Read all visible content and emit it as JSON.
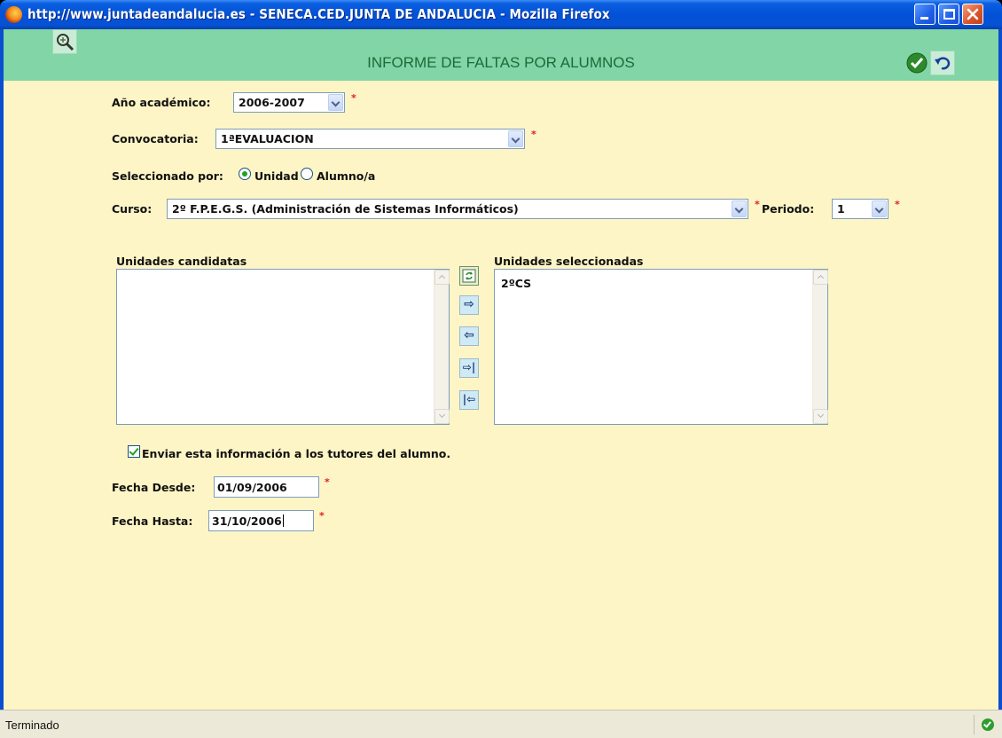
{
  "window": {
    "title": "http://www.juntadeandalucia.es - SENECA.CED.JUNTA DE ANDALUCIA - Mozilla Firefox"
  },
  "header": {
    "title": "INFORME DE FALTAS POR ALUMNOS"
  },
  "form": {
    "anio_label": "Año académico:",
    "anio_value": "2006-2007",
    "convocatoria_label": "Convocatoria:",
    "convocatoria_value": "1ªEVALUACION",
    "seleccionado_label": "Seleccionado por:",
    "radio_unidad": "Unidad",
    "radio_alumno": "Alumno/a",
    "curso_label": "Curso:",
    "curso_value": "2º F.P.E.G.S. (Administración de Sistemas Informáticos)",
    "periodo_label": "Periodo:",
    "periodo_value": "1",
    "required_mark": "*"
  },
  "lists": {
    "candidatas_label": "Unidades candidatas",
    "seleccionadas_label": "Unidades seleccionadas",
    "seleccionadas_items": [
      "2ºCS"
    ]
  },
  "move_buttons": {
    "add_one": "⇨",
    "remove_one": "⇦",
    "add_all": "⇨|",
    "remove_all": "|⇦"
  },
  "options": {
    "enviar_label": "Enviar esta información a los tutores del alumno.",
    "enviar_checked": true
  },
  "dates": {
    "desde_label": "Fecha Desde:",
    "desde_value": "01/09/2006",
    "hasta_label": "Fecha Hasta:",
    "hasta_value": "31/10/2006"
  },
  "status": {
    "text": "Terminado"
  },
  "icons": {
    "browser": "firefox-icon",
    "search": "search-icon",
    "accept": "check-icon",
    "undo": "undo-icon",
    "status": "check-icon"
  },
  "colors": {
    "header_bg": "#81d5a6",
    "content_bg": "#fdf5c5",
    "title_text": "#1d6b3a",
    "required": "#e02020"
  }
}
